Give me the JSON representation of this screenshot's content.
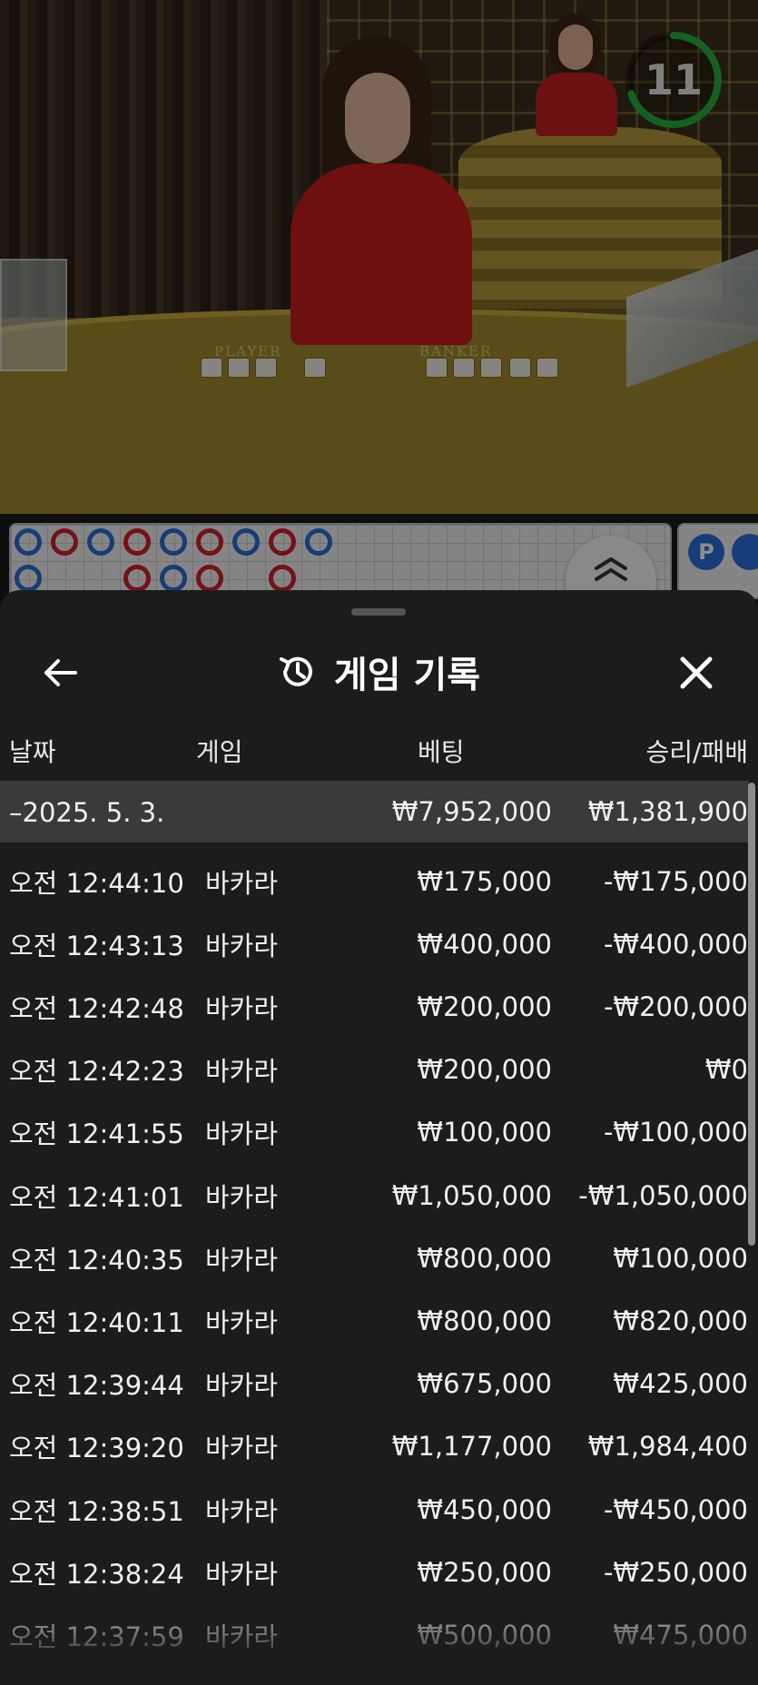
{
  "video": {
    "timer_value": "11",
    "player_label": "PLAYER",
    "banker_label": "BANKER"
  },
  "roadmap": {
    "top_row": [
      "blue",
      "red",
      "blue",
      "red",
      "blue",
      "red",
      "blue",
      "red",
      "blue"
    ],
    "second_row": [
      "blue",
      "",
      "",
      "red",
      "blue",
      "red",
      "",
      "red",
      ""
    ],
    "side_badge": "P"
  },
  "sheet": {
    "title": "게임 기록",
    "icons": {
      "back": "arrow-left-icon",
      "history": "history-clock-icon",
      "close": "close-icon"
    },
    "columns": {
      "date": "날짜",
      "game": "게임",
      "bet": "베팅",
      "win_loss": "승리/패배"
    },
    "date_group": {
      "label": "–2025. 5. 3.",
      "total_bet": "₩7,952,000",
      "total_result": "₩1,381,900"
    },
    "rows": [
      {
        "time": "오전 12:44:10",
        "game": "바카라",
        "bet": "₩175,000",
        "result": "-₩175,000"
      },
      {
        "time": "오전 12:43:13",
        "game": "바카라",
        "bet": "₩400,000",
        "result": "-₩400,000"
      },
      {
        "time": "오전 12:42:48",
        "game": "바카라",
        "bet": "₩200,000",
        "result": "-₩200,000"
      },
      {
        "time": "오전 12:42:23",
        "game": "바카라",
        "bet": "₩200,000",
        "result": "₩0"
      },
      {
        "time": "오전 12:41:55",
        "game": "바카라",
        "bet": "₩100,000",
        "result": "-₩100,000"
      },
      {
        "time": "오전 12:41:01",
        "game": "바카라",
        "bet": "₩1,050,000",
        "result": "-₩1,050,000"
      },
      {
        "time": "오전 12:40:35",
        "game": "바카라",
        "bet": "₩800,000",
        "result": "₩100,000"
      },
      {
        "time": "오전 12:40:11",
        "game": "바카라",
        "bet": "₩800,000",
        "result": "₩820,000"
      },
      {
        "time": "오전 12:39:44",
        "game": "바카라",
        "bet": "₩675,000",
        "result": "₩425,000"
      },
      {
        "time": "오전 12:39:20",
        "game": "바카라",
        "bet": "₩1,177,000",
        "result": "₩1,984,400"
      },
      {
        "time": "오전 12:38:51",
        "game": "바카라",
        "bet": "₩450,000",
        "result": "-₩450,000"
      },
      {
        "time": "오전 12:38:24",
        "game": "바카라",
        "bet": "₩250,000",
        "result": "-₩250,000"
      },
      {
        "time": "오전 12:37:59",
        "game": "바카라",
        "bet": "₩500,000",
        "result": "₩475,000"
      }
    ]
  },
  "colors": {
    "sheet_bg": "#1c1c1c",
    "date_row_bg": "#3a3a3a",
    "timer_ring": "#27b13b",
    "bead_blue": "#2a6fdb",
    "bead_red": "#d3222a"
  }
}
